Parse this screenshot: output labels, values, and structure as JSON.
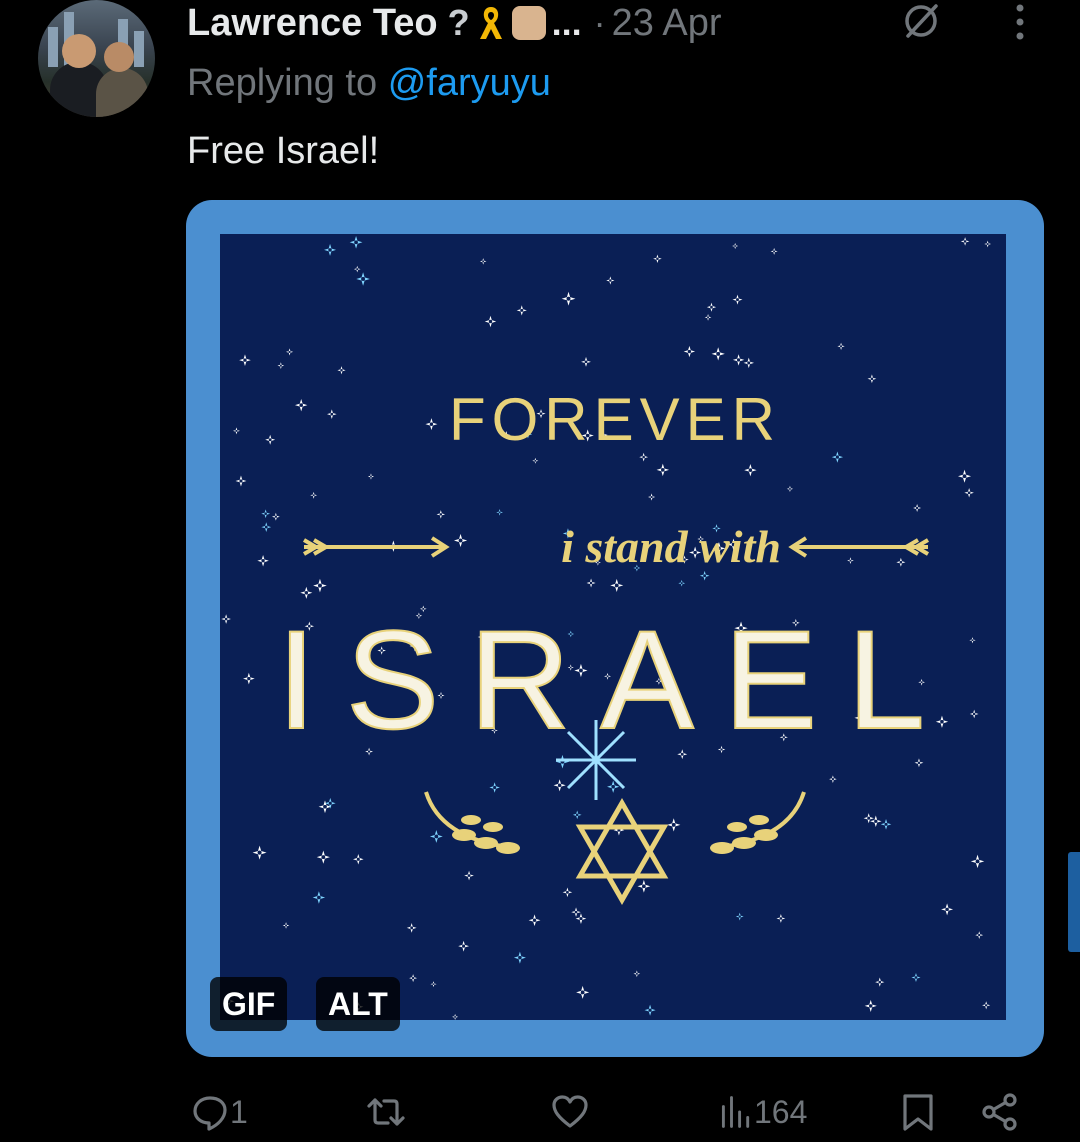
{
  "tweet": {
    "author_name": "Lawrence Teo",
    "author_emojis": [
      "question-mark",
      "yellow-ribbon",
      "raised-fist"
    ],
    "ellipsis": "...",
    "separator": "·",
    "date": "23 Apr",
    "replying_prefix": "Replying to",
    "replying_handle": "@faryuyu",
    "text": "Free Israel!"
  },
  "media": {
    "gif_badge": "GIF",
    "alt_badge": "ALT",
    "image_text": {
      "line1": "FOREVER",
      "line2": "i stand with",
      "line3": "ISRAEL"
    },
    "colors": {
      "frame": "#4b8fd0",
      "background": "#0a1f55",
      "gold": "#e8d27a"
    }
  },
  "actions": {
    "reply_count": "1",
    "retweet_count": "",
    "like_count": "",
    "views_count": "164"
  },
  "icons": {
    "reply": "reply-icon",
    "retweet": "retweet-icon",
    "like": "like-icon",
    "views": "views-icon",
    "bookmark": "bookmark-icon",
    "share": "share-icon",
    "grok": "grok-icon",
    "more": "more-icon"
  }
}
